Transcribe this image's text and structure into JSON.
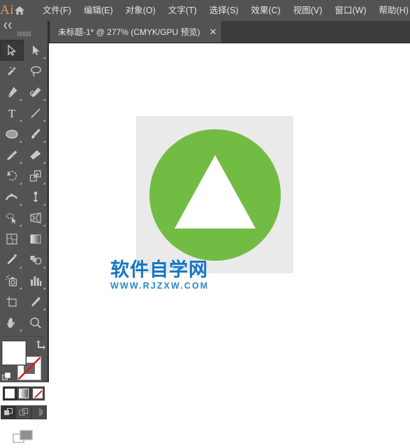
{
  "app": {
    "name": "Ai",
    "logo_color": "#d99a63",
    "chrome_bg": "#535353",
    "tabbar_bg": "#3c3c3c"
  },
  "menubar": {
    "home_icon": "home-icon",
    "items": [
      {
        "label": "文件(F)"
      },
      {
        "label": "编辑(E)"
      },
      {
        "label": "对象(O)"
      },
      {
        "label": "文字(T)"
      },
      {
        "label": "选择(S)"
      },
      {
        "label": "效果(C)"
      },
      {
        "label": "视图(V)"
      },
      {
        "label": "窗口(W)"
      },
      {
        "label": "帮助(H)"
      }
    ]
  },
  "tabbar": {
    "tabs": [
      {
        "label": "未标题-1* @ 277% (CMYK/GPU 预览)",
        "close_label": "✕",
        "active": true
      }
    ]
  },
  "toolpanel": {
    "collapse_label": "❮❮",
    "tools": [
      {
        "name": "selection-tool",
        "label": "选择工具",
        "active": true,
        "has_flyout": false
      },
      {
        "name": "direct-selection-tool",
        "label": "直接选择工具",
        "active": false,
        "has_flyout": true
      },
      {
        "name": "magic-wand-tool",
        "label": "魔棒工具",
        "active": false,
        "has_flyout": false
      },
      {
        "name": "lasso-tool",
        "label": "套索工具",
        "active": false,
        "has_flyout": false
      },
      {
        "name": "pen-tool",
        "label": "钢笔工具",
        "active": false,
        "has_flyout": true
      },
      {
        "name": "curvature-tool",
        "label": "曲率工具",
        "active": false,
        "has_flyout": true
      },
      {
        "name": "type-tool",
        "label": "文字工具",
        "active": false,
        "has_flyout": true
      },
      {
        "name": "line-segment-tool",
        "label": "直线段工具",
        "active": false,
        "has_flyout": true
      },
      {
        "name": "ellipse-tool",
        "label": "椭圆工具",
        "active": false,
        "has_flyout": true
      },
      {
        "name": "paintbrush-tool",
        "label": "画笔工具",
        "active": false,
        "has_flyout": true
      },
      {
        "name": "shaper-pencil-tool",
        "label": "铅笔工具",
        "active": false,
        "has_flyout": true
      },
      {
        "name": "eraser-tool",
        "label": "橡皮擦工具",
        "active": false,
        "has_flyout": true
      },
      {
        "name": "rotate-tool",
        "label": "旋转工具",
        "active": false,
        "has_flyout": true
      },
      {
        "name": "scale-tool",
        "label": "比例缩放工具",
        "active": false,
        "has_flyout": true
      },
      {
        "name": "width-tool",
        "label": "宽度工具",
        "active": false,
        "has_flyout": true
      },
      {
        "name": "free-transform-tool",
        "label": "自由变换工具",
        "active": false,
        "has_flyout": true
      },
      {
        "name": "shape-builder-tool",
        "label": "形状生成器工具",
        "active": false,
        "has_flyout": true
      },
      {
        "name": "perspective-grid-tool",
        "label": "透视网格工具",
        "active": false,
        "has_flyout": true
      },
      {
        "name": "mesh-tool",
        "label": "网格工具",
        "active": false,
        "has_flyout": false
      },
      {
        "name": "gradient-tool",
        "label": "渐变工具",
        "active": false,
        "has_flyout": false
      },
      {
        "name": "eyedropper-tool",
        "label": "吸管工具",
        "active": false,
        "has_flyout": true
      },
      {
        "name": "blend-tool",
        "label": "混合工具",
        "active": false,
        "has_flyout": true
      },
      {
        "name": "symbol-sprayer-tool",
        "label": "符号喷枪工具",
        "active": false,
        "has_flyout": true
      },
      {
        "name": "column-graph-tool",
        "label": "柱形图工具",
        "active": false,
        "has_flyout": true
      },
      {
        "name": "artboard-tool",
        "label": "画板工具",
        "active": false,
        "has_flyout": false
      },
      {
        "name": "slice-tool",
        "label": "切片工具",
        "active": false,
        "has_flyout": true
      },
      {
        "name": "hand-tool",
        "label": "抓手工具",
        "active": false,
        "has_flyout": true
      },
      {
        "name": "zoom-tool",
        "label": "缩放工具",
        "active": false,
        "has_flyout": false
      }
    ],
    "fill_stroke": {
      "fill_label": "填色",
      "fill_color": "#ffffff",
      "stroke_label": "描边",
      "stroke_color": "none",
      "swap_label": "互换填色和描边",
      "default_label": "默认填色和描边"
    },
    "paint_modes": [
      {
        "name": "color-mode",
        "label": "颜色",
        "selected": true
      },
      {
        "name": "gradient-mode",
        "label": "渐变",
        "selected": false
      },
      {
        "name": "none-mode",
        "label": "无",
        "selected": false
      }
    ],
    "draw_modes": [
      {
        "name": "draw-normal-mode",
        "label": "正常绘图",
        "selected": true
      },
      {
        "name": "draw-behind-mode",
        "label": "背面绘图",
        "selected": false
      },
      {
        "name": "draw-inside-mode",
        "label": "内部绘图",
        "selected": false
      }
    ],
    "screen_mode": {
      "name": "change-screen-mode",
      "label": "更改屏幕模式"
    }
  },
  "canvas": {
    "background": "#ffffff",
    "artboard": {
      "label": "画板 1",
      "background": "#eaeaea"
    },
    "artwork": {
      "circle": {
        "label": "绿色圆形",
        "color": "#72bc44"
      },
      "triangle": {
        "label": "白色三角形",
        "color": "#ffffff"
      }
    },
    "watermark": {
      "cn": "软件自学网",
      "en": "WWW.RJZXW.COM",
      "color": "#1577c4"
    }
  }
}
